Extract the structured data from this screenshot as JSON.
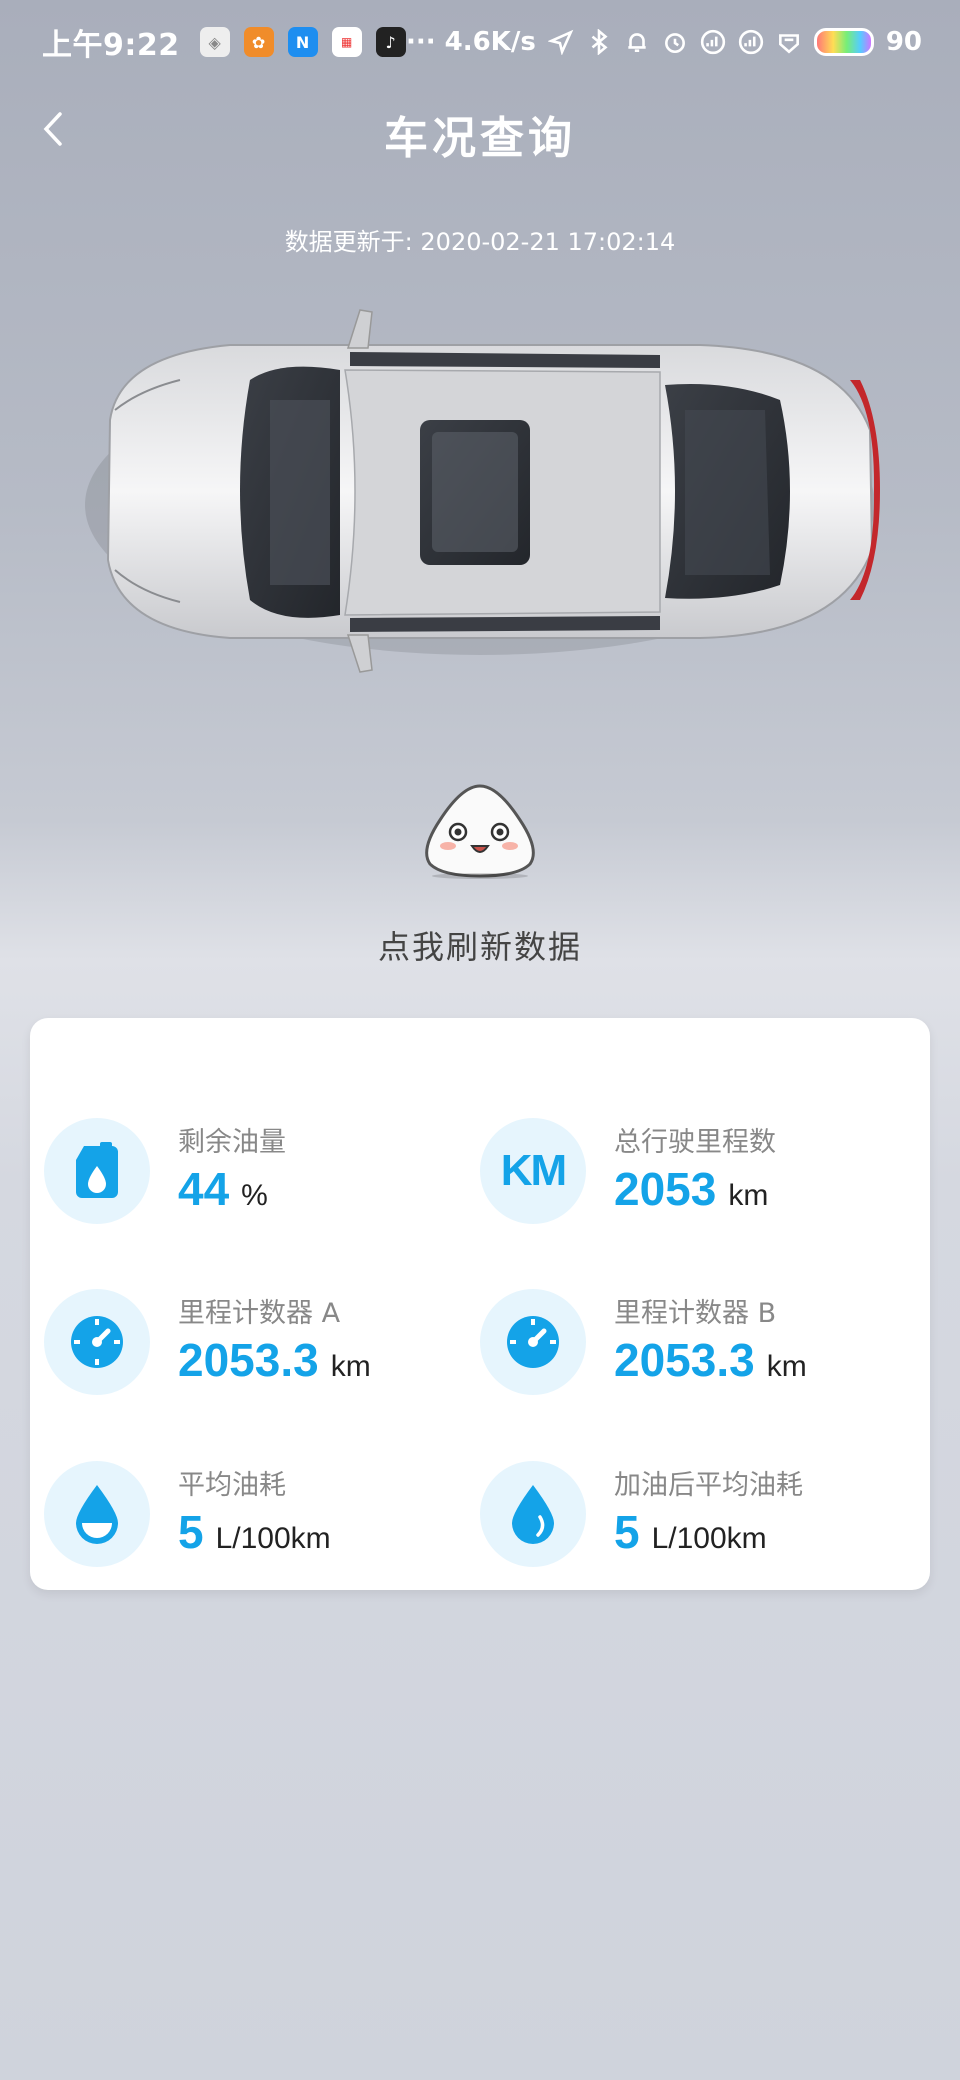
{
  "status_bar": {
    "time": "上午9:22",
    "network_speed": "··· 4.6K/s",
    "battery": "90",
    "apps": [
      "meitu-icon",
      "squirrel-icon",
      "nfc-n-icon",
      "news-icon",
      "tiktok-icon"
    ],
    "system_icons": [
      "location-icon",
      "bluetooth-icon",
      "bell-off-icon",
      "alarm-icon",
      "sim-icon",
      "sim-icon",
      "hd-icon"
    ]
  },
  "header": {
    "title": "车况查询"
  },
  "update": {
    "text": "数据更新于: 2020-02-21 17:02:14"
  },
  "refresh": {
    "label": "点我刷新数据"
  },
  "stats": [
    {
      "label": "剩余油量",
      "value": "44",
      "unit": "%",
      "icon": "fuel-can-icon"
    },
    {
      "label": "总行驶里程数",
      "value": "2053",
      "unit": "km",
      "icon": "km-icon"
    },
    {
      "label": "里程计数器 A",
      "value": "2053.3",
      "unit": "km",
      "icon": "gauge-icon"
    },
    {
      "label": "里程计数器 B",
      "value": "2053.3",
      "unit": "km",
      "icon": "gauge-icon"
    },
    {
      "label": "平均油耗",
      "value": "5",
      "unit": "L/100km",
      "icon": "drop-icon"
    },
    {
      "label": "加油后平均油耗",
      "value": "5",
      "unit": "L/100km",
      "icon": "drop-icon"
    }
  ],
  "colors": {
    "accent": "#14a3e8",
    "icon_bg": "#e6f5fd",
    "card_bg": "#ffffff"
  }
}
